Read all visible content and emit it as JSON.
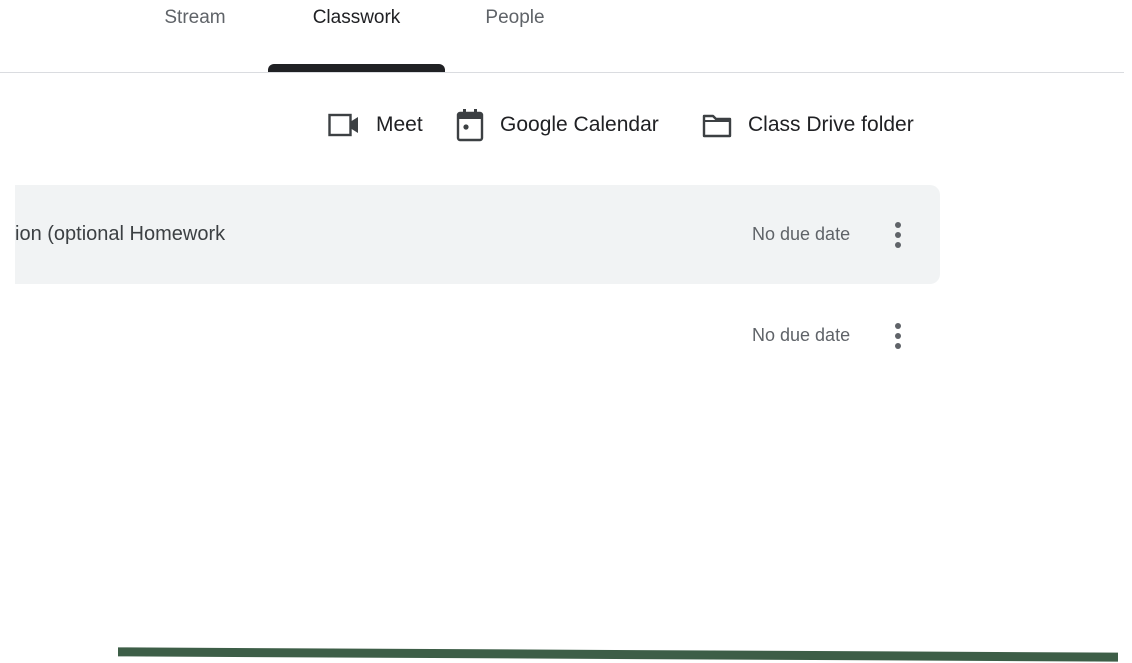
{
  "tabs": {
    "stream": "Stream",
    "classwork": "Classwork",
    "people": "People",
    "active": "Classwork"
  },
  "toolbar": {
    "meet": {
      "label": "Meet",
      "icon": "video-camera-icon"
    },
    "calendar": {
      "label": "Google Calendar",
      "icon": "calendar-icon"
    },
    "drive": {
      "label": "Class Drive folder",
      "icon": "folder-icon"
    }
  },
  "items": [
    {
      "title": "ion (optional Homework",
      "due": "No due date",
      "highlighted": true
    },
    {
      "title": "",
      "due": "No due date",
      "highlighted": false
    }
  ],
  "colors": {
    "text": "#202124",
    "muted": "#5f6368",
    "row_highlight": "#f1f3f4",
    "bottom_bar": "#3d5e47"
  }
}
